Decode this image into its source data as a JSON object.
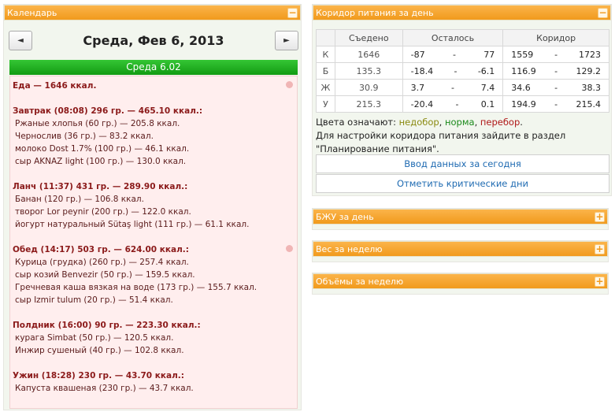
{
  "calendar": {
    "panel_title": "Календарь",
    "collapse_symbol": "−",
    "prev_symbol": "◄",
    "next_symbol": "►",
    "date_title": "Среда, Фев 6, 2013",
    "day_bar": "Среда 6.02",
    "lines": [
      "Еда — 1646 ккал.",
      "",
      "Завтрак (08:08) 296 гр. — 465.10 ккал.:",
      "Ржаные хлопья (60 гр.) — 205.8 ккал.",
      "Чернослив (36 гр.) — 83.2 ккал.",
      "молоко Dost 1.7% (100 гр.) — 46.1 ккал.",
      "сыр AKNAZ light (100 гр.) — 130.0 ккал.",
      "",
      "Ланч (11:37) 431 гр. — 289.90 ккал.:",
      "Банан (120 гр.) — 106.8 ккал.",
      "творог Lor peynir (200 гр.) — 122.0 ккал.",
      "йогурт натуральный Sütaş light (111 гр.) — 61.1 ккал.",
      "",
      "Обед (14:17) 503 гр. — 624.00 ккал.:",
      "Курица (грудка) (260 гр.) — 257.4 ккал.",
      "сыр козий Benvezir (50 гр.) — 159.5 ккал.",
      "Гречневая каша вязкая на воде (173 гр.) — 155.7 ккал.",
      "сыр Izmir tulum (20 гр.) — 51.4 ккал.",
      "",
      "Полдник (16:00) 90 гр. — 223.30 ккал.:",
      "курага Simbat (50 гр.) — 120.5 ккал.",
      "Инжир сушеный (40 гр.) — 102.8 ккал.",
      "",
      "Ужин (18:28) 230 гр. — 43.70 ккал.:",
      "Капуста квашеная (230 гр.) — 43.7 ккал."
    ]
  },
  "corridor": {
    "panel_title": "Коридор питания за день",
    "collapse_symbol": "−",
    "headers": [
      "",
      "Съедено",
      "Осталось",
      "Коридор"
    ],
    "dash": "-",
    "rows": [
      {
        "k": "К",
        "eaten": "1646",
        "left_a": "-87",
        "left_b": "77",
        "corr_a": "1559",
        "corr_b": "1723"
      },
      {
        "k": "Б",
        "eaten": "135.3",
        "left_a": "-18.4",
        "left_b": "-6.1",
        "corr_a": "116.9",
        "corr_b": "129.2"
      },
      {
        "k": "Ж",
        "eaten": "30.9",
        "left_a": "3.7",
        "left_b": "7.4",
        "corr_a": "34.6",
        "corr_b": "38.3"
      },
      {
        "k": "У",
        "eaten": "215.3",
        "left_a": "-20.4",
        "left_b": "0.1",
        "corr_a": "194.9",
        "corr_b": "215.4"
      }
    ],
    "legend_prefix": "Цвета означают: ",
    "legend_under": "недобор",
    "legend_sep1": ", ",
    "legend_ok": "норма",
    "legend_sep2": ", ",
    "legend_over": "перебор",
    "legend_end": ".",
    "hint_line1": "Для настройки коридора питания зайдите в раздел",
    "hint_line2": "\"Планирование питания\".",
    "btn_input": "Ввод данных за сегодня",
    "btn_critical": "Отметить критические дни"
  },
  "collapsed_panels": {
    "expand_symbol": "+",
    "bju": "БЖУ за день",
    "weight": "Вес за неделю",
    "volumes": "Объёмы за неделю"
  },
  "colors": {
    "header_orange": "#f19a1c",
    "day_green": "#129b12",
    "norm": "#1a8a1a",
    "over": "#b01818",
    "under": "#8a8a10",
    "link": "#1f6bb2"
  }
}
